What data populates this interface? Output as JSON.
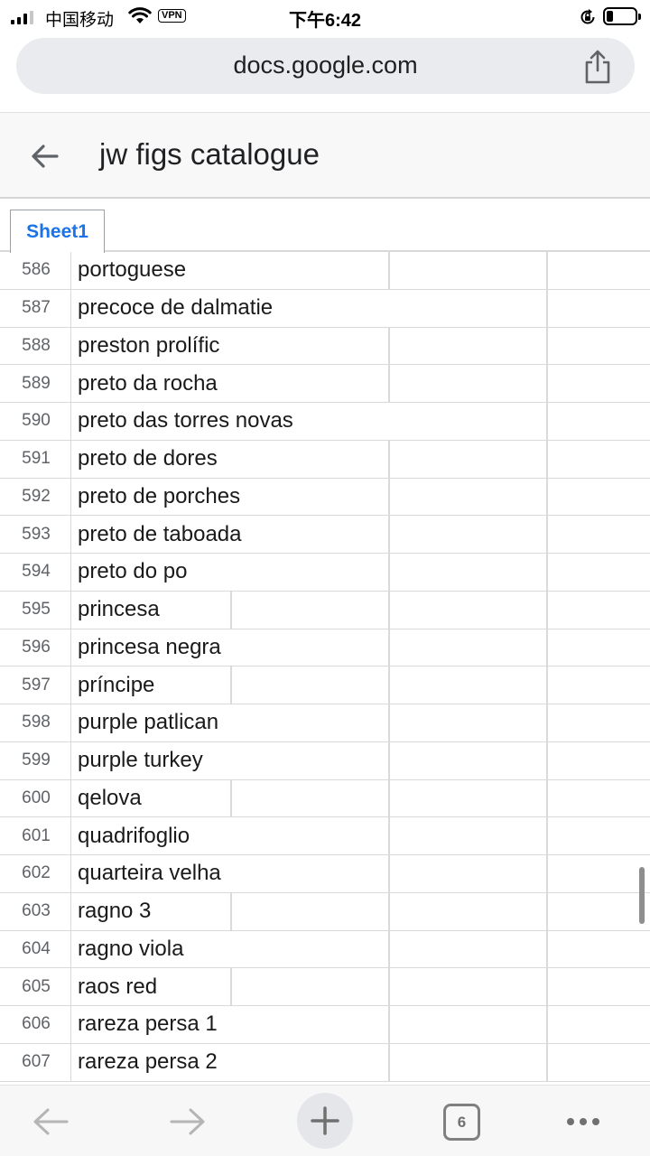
{
  "status_bar": {
    "carrier": "中国移动",
    "vpn_label": "VPN",
    "time": "下午6:42"
  },
  "browser": {
    "url": "docs.google.com",
    "tab_count": "6"
  },
  "app_header": {
    "title": "jw figs catalogue"
  },
  "sheet_tab": {
    "label": "Sheet1"
  },
  "rows": [
    {
      "num": "586",
      "name": "portoguese"
    },
    {
      "num": "587",
      "name": "precoce de dalmatie"
    },
    {
      "num": "588",
      "name": "preston prolífic"
    },
    {
      "num": "589",
      "name": "preto da rocha"
    },
    {
      "num": "590",
      "name": "preto das torres novas"
    },
    {
      "num": "591",
      "name": "preto de dores"
    },
    {
      "num": "592",
      "name": "preto de porches"
    },
    {
      "num": "593",
      "name": "preto de taboada"
    },
    {
      "num": "594",
      "name": "preto do po"
    },
    {
      "num": "595",
      "name": "princesa"
    },
    {
      "num": "596",
      "name": "princesa negra"
    },
    {
      "num": "597",
      "name": "príncipe"
    },
    {
      "num": "598",
      "name": "purple patlican"
    },
    {
      "num": "599",
      "name": "purple turkey"
    },
    {
      "num": "600",
      "name": "qelova"
    },
    {
      "num": "601",
      "name": "quadrifoglio"
    },
    {
      "num": "602",
      "name": "quarteira velha"
    },
    {
      "num": "603",
      "name": "ragno 3"
    },
    {
      "num": "604",
      "name": "ragno viola"
    },
    {
      "num": "605",
      "name": "raos red"
    },
    {
      "num": "606",
      "name": "rareza persa 1"
    },
    {
      "num": "607",
      "name": "rareza persa 2"
    }
  ],
  "colors": {
    "accent": "#1a73e8",
    "gridline": "#d9d9d9"
  }
}
